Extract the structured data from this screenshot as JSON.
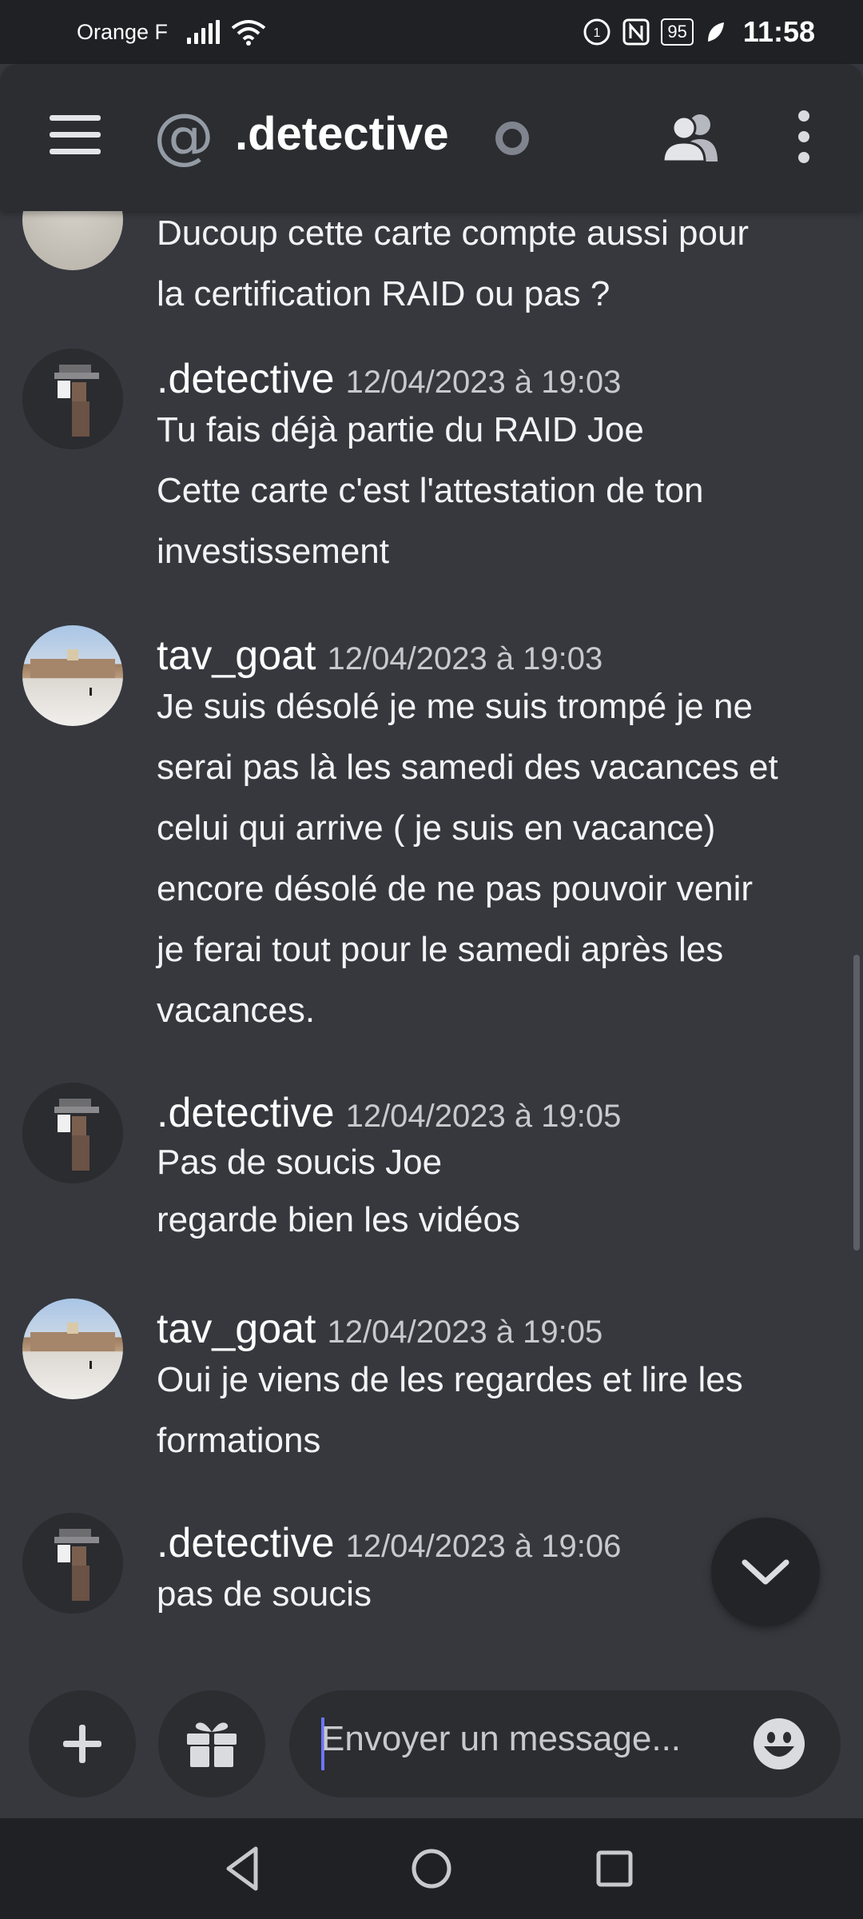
{
  "status_bar": {
    "carrier": "Orange F",
    "battery": "95",
    "time": "11:58"
  },
  "header": {
    "channel_name": ".detective"
  },
  "messages": [
    {
      "author": "",
      "timestamp": "",
      "lines": [
        "Ducoup cette carte compte aussi pour",
        "la certification RAID ou pas ?"
      ]
    },
    {
      "author": ".detective",
      "timestamp": "12/04/2023 à 19:03",
      "lines": [
        "Tu fais déjà partie du RAID Joe",
        "Cette carte c'est l'attestation de ton",
        "investissement"
      ]
    },
    {
      "author": "tav_goat",
      "timestamp": "12/04/2023 à 19:03",
      "lines": [
        "Je suis désolé je me suis trompé je ne",
        "serai pas là les samedi des vacances et",
        "celui qui arrive ( je suis en vacance)",
        "encore désolé de ne pas pouvoir venir",
        "je ferai tout pour le samedi après les",
        "vacances."
      ]
    },
    {
      "author": ".detective",
      "timestamp": "12/04/2023 à 19:05",
      "lines": [
        "Pas de soucis Joe",
        "regarde bien les vidéos"
      ]
    },
    {
      "author": "tav_goat",
      "timestamp": "12/04/2023 à 19:05",
      "lines": [
        "Oui je viens de les regardes et lire les",
        "formations"
      ]
    },
    {
      "author": ".detective",
      "timestamp": "12/04/2023 à 19:06",
      "lines": [
        "pas de soucis"
      ]
    }
  ],
  "composer": {
    "placeholder": "Envoyer un message..."
  },
  "colors": {
    "background": "#36383e",
    "header": "#2b2d31",
    "system_bar": "#1f2124",
    "caret": "#6b75ff"
  },
  "icons": {
    "menu": "hamburger-icon",
    "dm": "at-icon",
    "members": "members-icon",
    "more": "more-vertical-icon",
    "jump": "chevron-down-icon",
    "add": "plus-icon",
    "gift": "gift-icon",
    "emoji": "emoji-icon"
  }
}
